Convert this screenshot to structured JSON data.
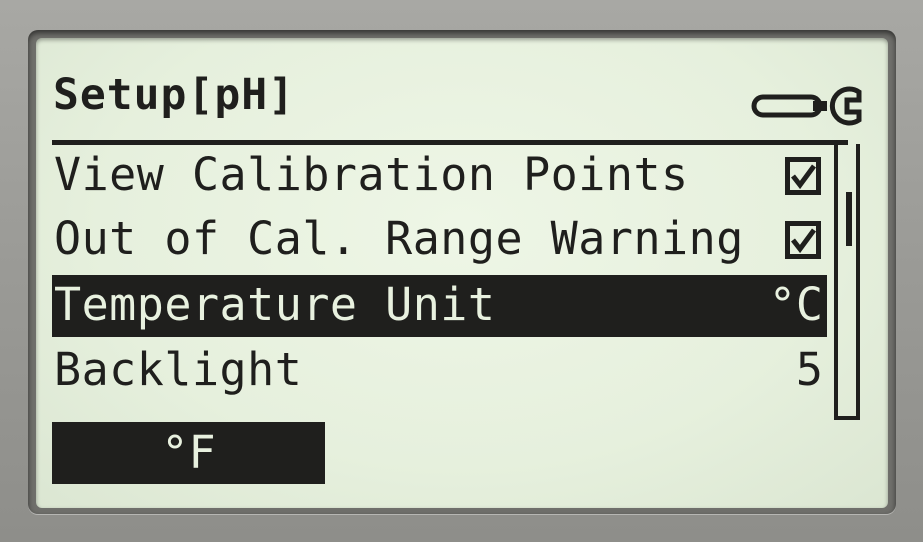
{
  "screen": {
    "title": "Setup[pH]"
  },
  "menu": {
    "items": [
      {
        "label": "View Calibration Points",
        "value_type": "checkbox",
        "checked": true
      },
      {
        "label": "Out of Cal. Range Warning",
        "value_type": "checkbox",
        "checked": true
      },
      {
        "label": "Temperature Unit",
        "value": "°C",
        "selected": true
      },
      {
        "label": "Backlight",
        "value": "5"
      }
    ]
  },
  "softkey": {
    "label": "°F"
  },
  "icons": {
    "header": "wrench-icon",
    "checkbox": "checkbox-checked-icon"
  },
  "colors": {
    "lcd_background": "#e6f0dd",
    "lcd_ink": "#1f1f1d"
  }
}
